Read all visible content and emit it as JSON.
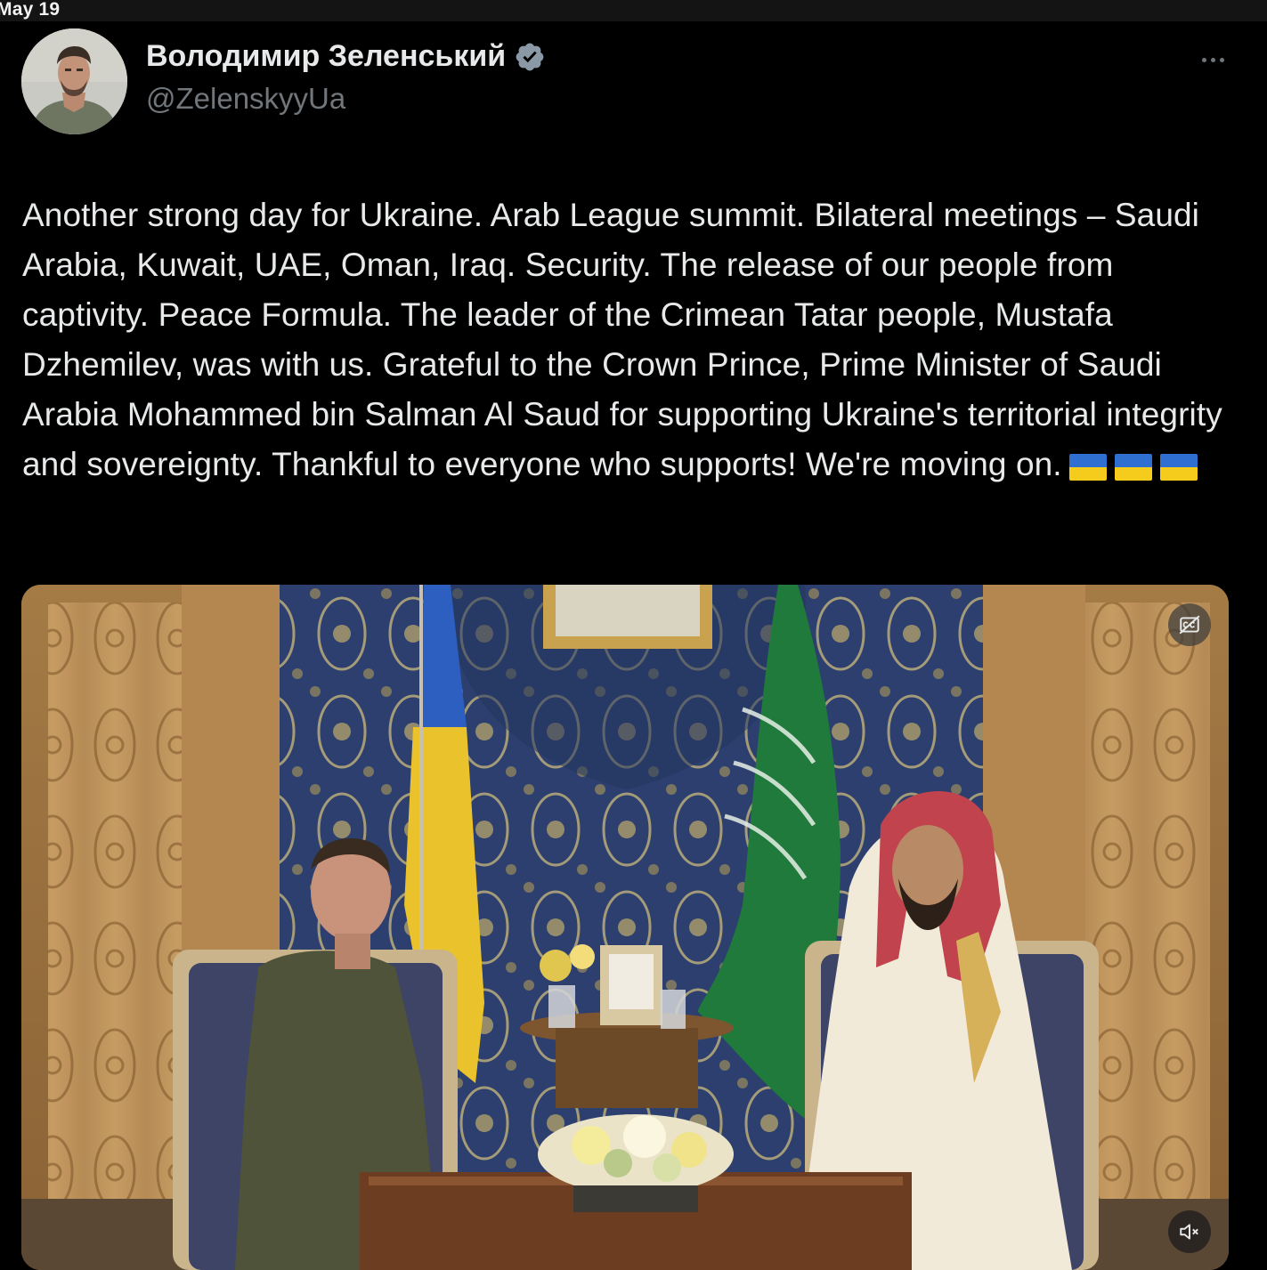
{
  "top_bar": {
    "date": "May 19"
  },
  "tweet": {
    "author": {
      "display_name": "Володимир Зеленський",
      "handle": "@ZelenskyyUa",
      "verified": true,
      "avatar_icon": "user-avatar"
    },
    "text": "Another strong day for Ukraine. Arab League summit. Bilateral meetings – Saudi Arabia, Kuwait, UAE, Oman, Iraq. Security. The release of our people from captivity. Peace Formula. The leader of the Crimean Tatar people, Mustafa Dzhemilev, was with us. Grateful to the Crown Prince, Prime Minister of Saudi Arabia Mohammed bin Salman Al Saud for supporting Ukraine's territorial integrity and sovereignty. Thankful to everyone who supports! We're moving on.",
    "emoji": [
      "🇺🇦",
      "🇺🇦",
      "🇺🇦"
    ],
    "more_icon": "more-horizontal-icon",
    "media": {
      "type": "video",
      "captions_icon": "captions-off-icon",
      "mute_icon": "volume-muted-icon"
    }
  },
  "colors": {
    "background": "#000000",
    "text_primary": "#e7e9ea",
    "text_secondary": "#71767b",
    "verified_badge": "#8b98a5",
    "flag_blue": "#2f6fd1",
    "flag_yellow": "#f6cc1c"
  }
}
